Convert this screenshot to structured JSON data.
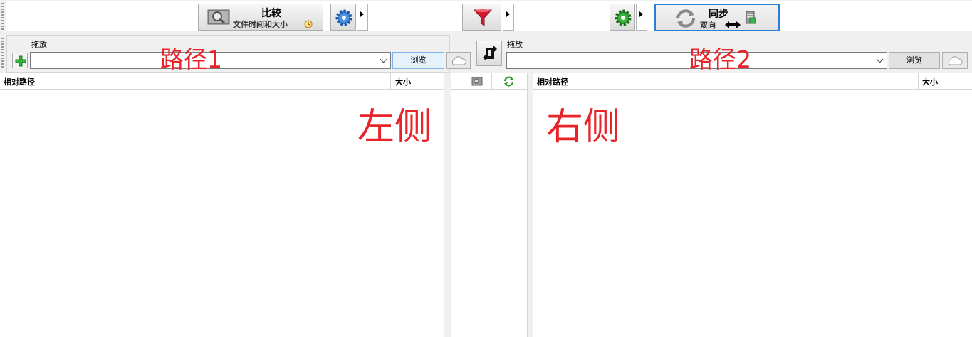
{
  "toolbar": {
    "compare_title": "比较",
    "compare_subtitle": "文件时间和大小",
    "sync_title": "同步",
    "sync_subtitle": "双向"
  },
  "left": {
    "drop_label": "拖放",
    "browse_label": "浏览",
    "annotation_path": "路径1",
    "annotation_side": "左侧",
    "col_path": "相对路径",
    "col_size": "大小"
  },
  "right": {
    "drop_label": "拖放",
    "browse_label": "浏览",
    "annotation_path": "路径2",
    "annotation_side": "右侧",
    "col_path": "相对路径",
    "col_size": "大小"
  },
  "colors": {
    "annotation": "#e8242b",
    "sync_border": "#2a7fd4",
    "filter_red": "#d11a2a",
    "gear_blue": "#3a7fd0",
    "gear_green": "#2f9a2f"
  }
}
